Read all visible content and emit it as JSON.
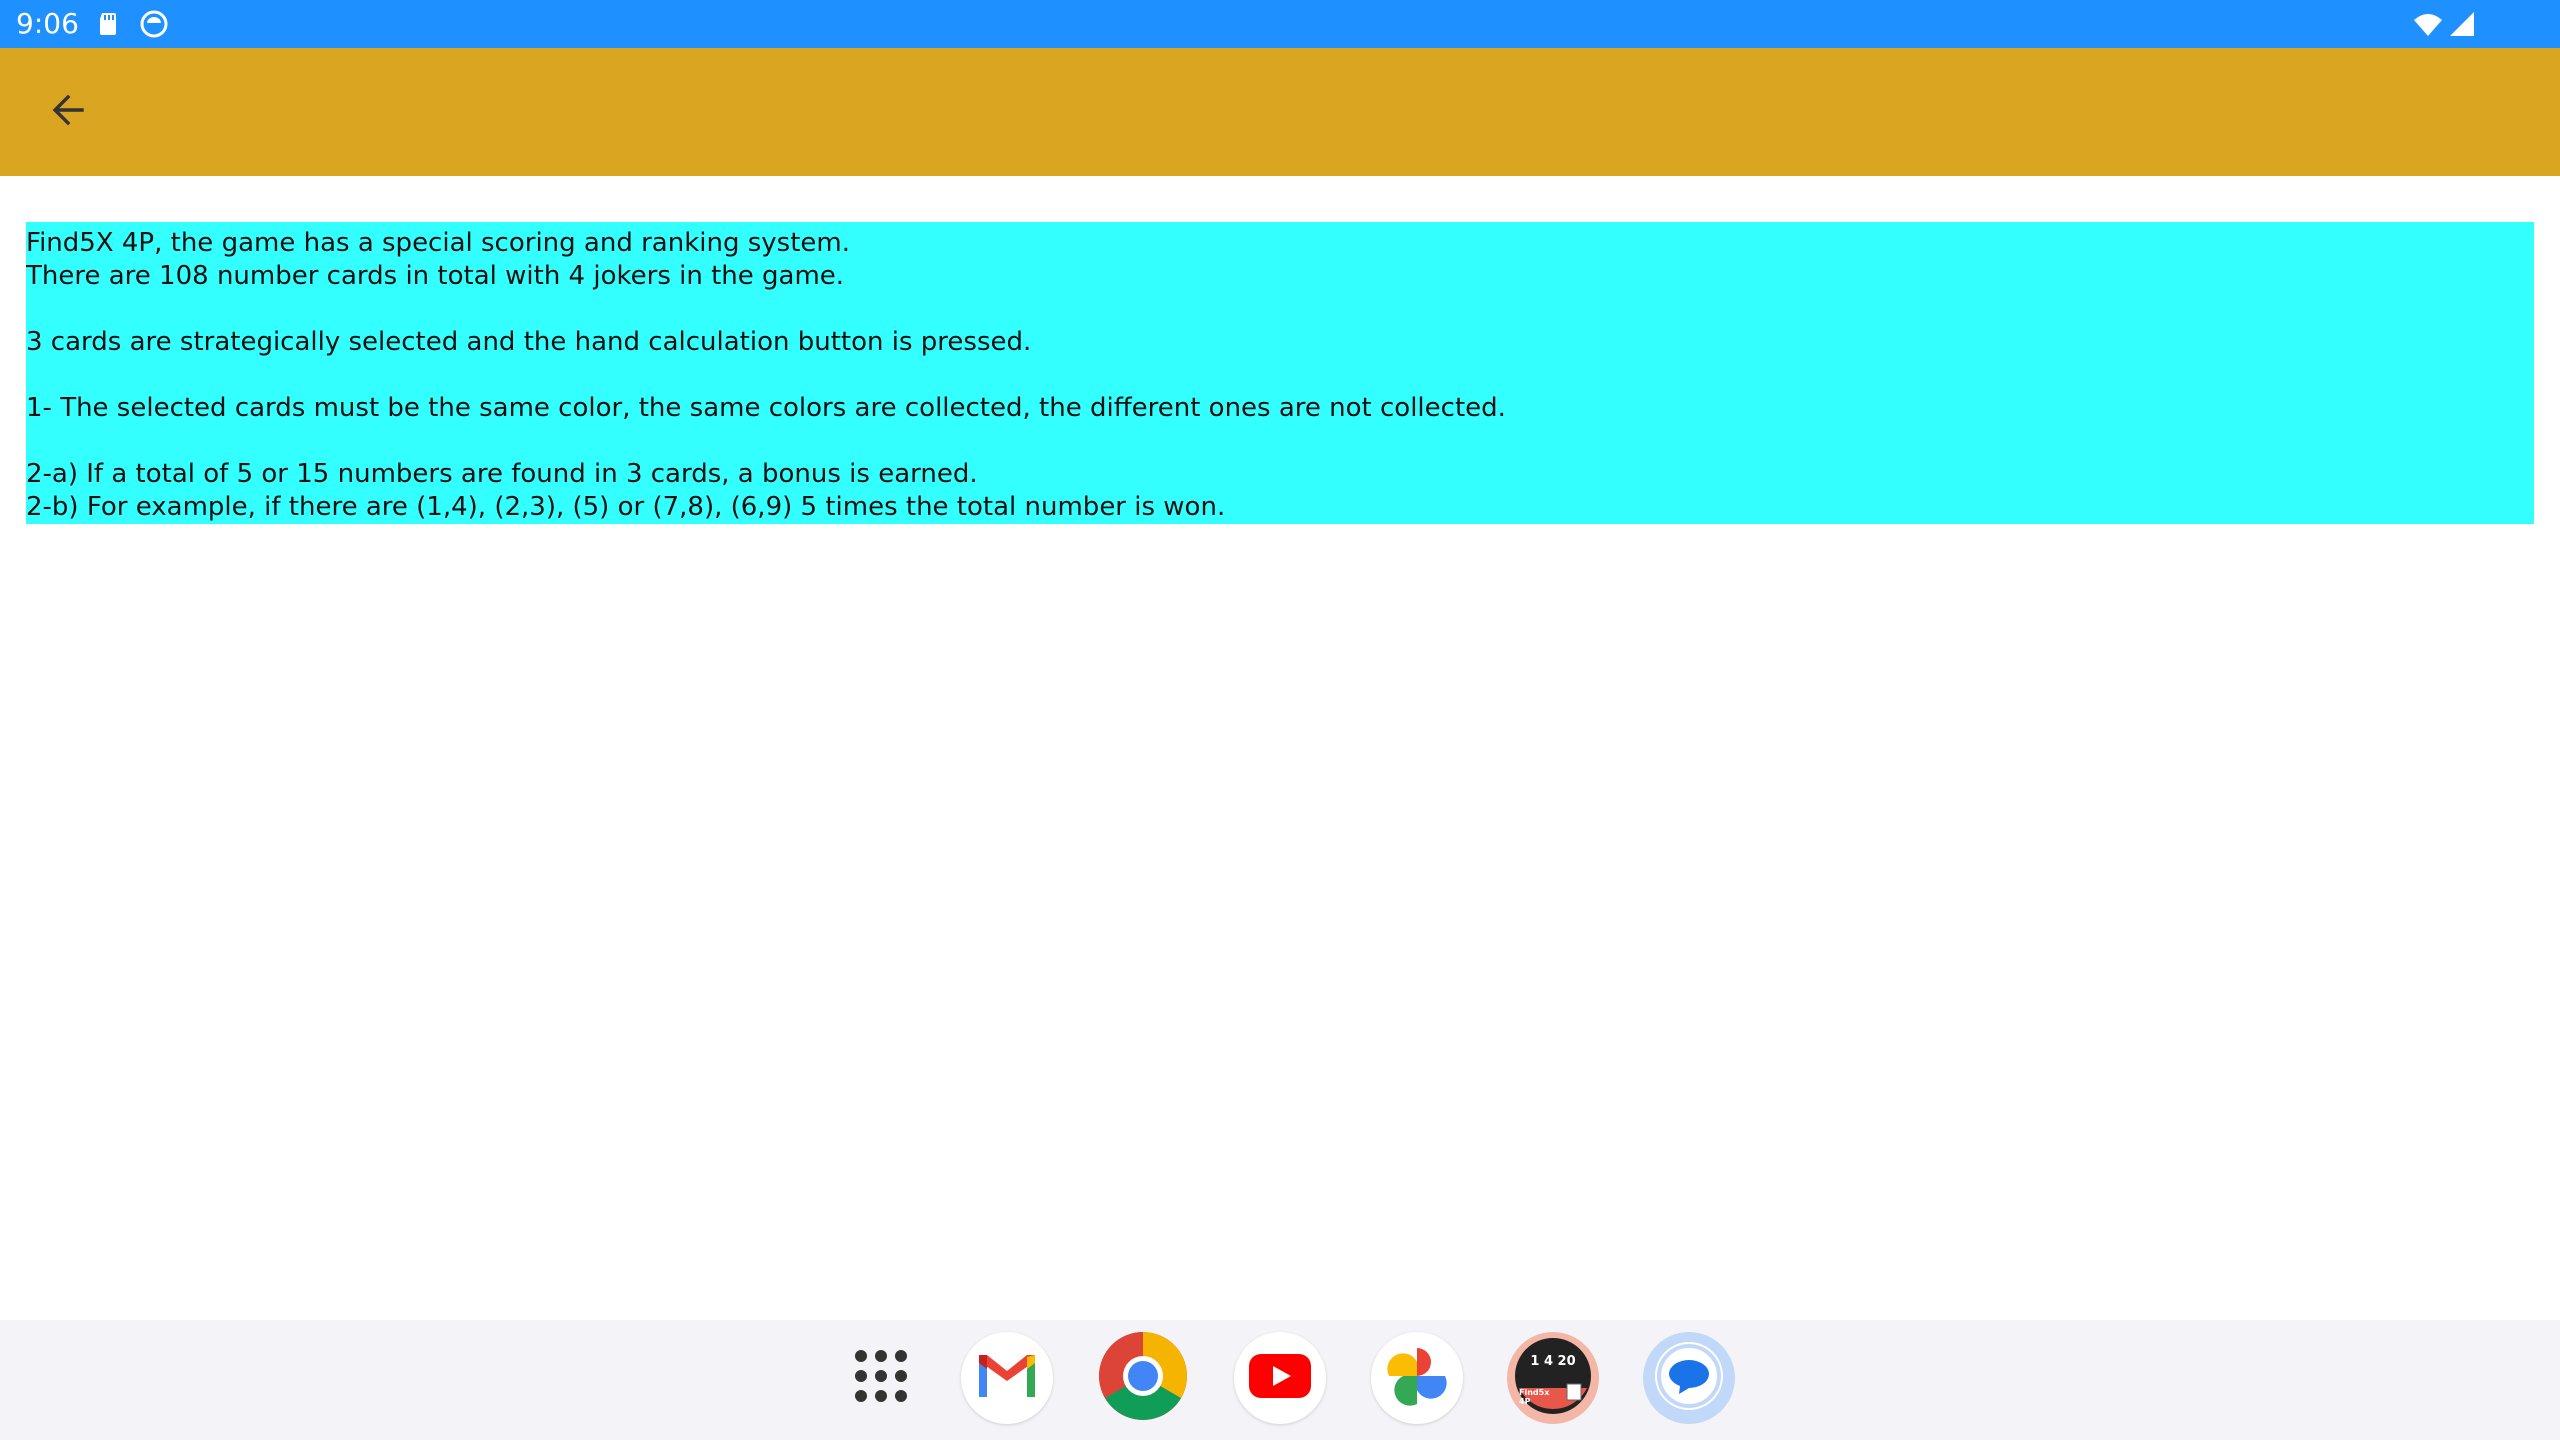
{
  "status_bar": {
    "time": "9:06",
    "left_icons": [
      "sd-card-icon",
      "app-notification-icon"
    ],
    "right_icons": [
      "wifi-icon",
      "cell-signal-icon"
    ],
    "color": "#1e90ff"
  },
  "app_bar": {
    "back_icon": "arrow-back-icon",
    "color": "#daa520"
  },
  "content": {
    "background": "#33ffff",
    "text": "Find5X 4P, the game has a special scoring and ranking system.\nThere are 108 number cards in total with 4 jokers in the game.\n\n3 cards are strategically selected and the hand calculation button is pressed.\n\n1- The selected cards must be the same color, the same colors are collected, the different ones are not collected.\n\n2-a) If a total of 5 or 15 numbers are found in 3 cards, a bonus is earned.\n2-b) For example, if there are (1,4), (2,3), (5) or (7,8), (6,9) 5 times the total number is won."
  },
  "dock": {
    "apps": [
      {
        "icon": "app-drawer-icon"
      },
      {
        "icon": "gmail-icon"
      },
      {
        "icon": "chrome-icon"
      },
      {
        "icon": "youtube-icon"
      },
      {
        "icon": "photos-icon"
      },
      {
        "icon": "find5x-game-icon",
        "label_top": "1 4 20",
        "label_bottom": "Find5x 4P"
      },
      {
        "icon": "messages-icon"
      }
    ]
  }
}
